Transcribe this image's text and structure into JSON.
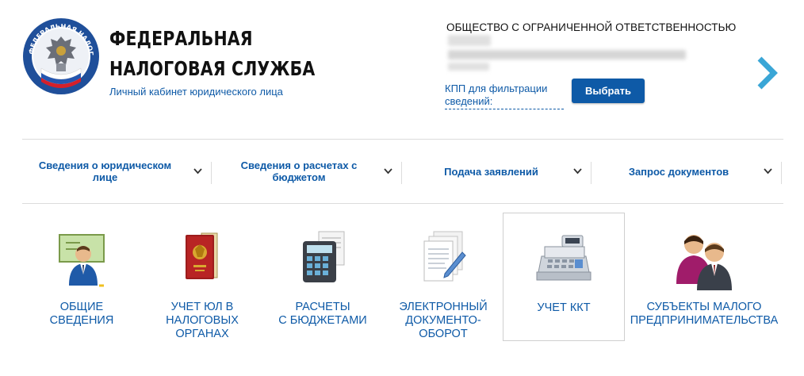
{
  "header": {
    "title_line1": "ФЕДЕРАЛЬНАЯ",
    "title_line2": "НАЛОГОВАЯ СЛУЖБА",
    "subtitle": "Личный кабинет юридического лица",
    "emblem_text": "ФЕДЕРАЛЬНАЯ НАЛОГОВАЯ СЛУЖБА"
  },
  "company": {
    "type": "ОБЩЕСТВО С ОГРАНИЧЕННОЙ ОТВЕТСТВЕННОСТЬЮ",
    "kpp_line1": "КПП для фильтрации",
    "kpp_line2": "сведений:",
    "select_label": "Выбрать"
  },
  "nav": {
    "items": [
      {
        "line1": "Сведения о юридическом",
        "line2": "лице"
      },
      {
        "line1": "Сведения о расчетах с",
        "line2": "бюджетом"
      },
      {
        "line1": "Подача заявлений",
        "line2": ""
      },
      {
        "line1": "Запрос документов",
        "line2": ""
      }
    ]
  },
  "tiles": [
    {
      "icon": "presenter-icon",
      "lines": [
        "ОБЩИЕ",
        "СВЕДЕНИЯ"
      ]
    },
    {
      "icon": "passport-icon",
      "lines": [
        "УЧЕТ ЮЛ В",
        "НАЛОГОВЫХ",
        "ОРГАНАХ"
      ]
    },
    {
      "icon": "calculator-icon",
      "lines": [
        "РАСЧЕТЫ",
        "С БЮДЖЕТАМИ"
      ]
    },
    {
      "icon": "documents-icon",
      "lines": [
        "ЭЛЕКТРОННЫЙ",
        "ДОКУМЕНТО-",
        "ОБОРОТ"
      ]
    },
    {
      "icon": "cash-register-icon",
      "lines": [
        "УЧЕТ ККТ"
      ]
    },
    {
      "icon": "businesspeople-icon",
      "lines": [
        "СУБЪЕКТЫ МАЛОГО",
        "ПРЕДПРИНИМАТЕЛЬСТВА"
      ]
    }
  ],
  "colors": {
    "link_blue": "#0e5aa7",
    "button_blue": "#0e5aa7",
    "arrow_cyan": "#3aa6d6",
    "divider": "#dcdcdc"
  }
}
